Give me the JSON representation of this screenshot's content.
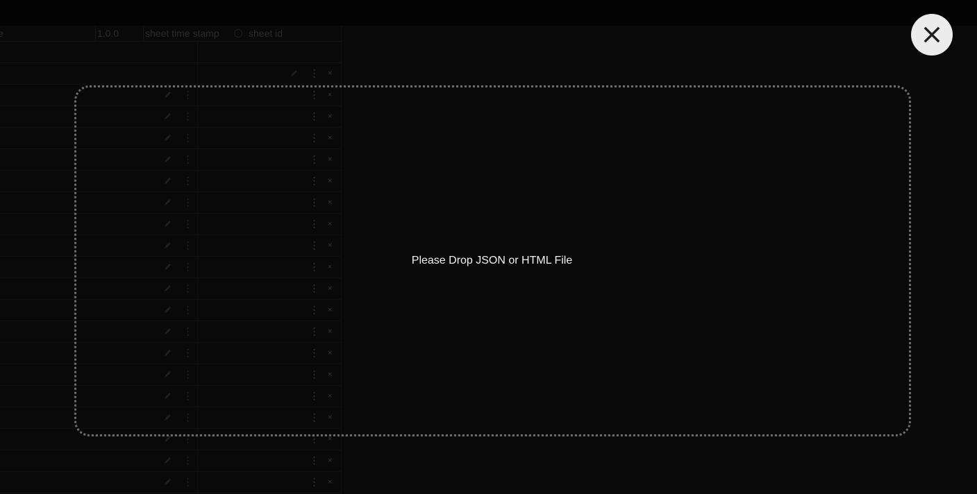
{
  "sheet": {
    "header": {
      "name_cell": "le",
      "version": "1.0.0",
      "timestamp_placeholder": "sheet time stamp",
      "id_placeholder": "sheet id"
    },
    "row_count": 20,
    "delete_glyph": "×"
  },
  "dropzone": {
    "message": "Please Drop JSON or HTML File"
  },
  "close_button": {
    "icon": "close-icon",
    "color": "#ececec"
  },
  "colors": {
    "backdrop": "#0c0c0c",
    "dropzone_border": "#6e6e6e",
    "message_text": "#f2f2f2"
  }
}
